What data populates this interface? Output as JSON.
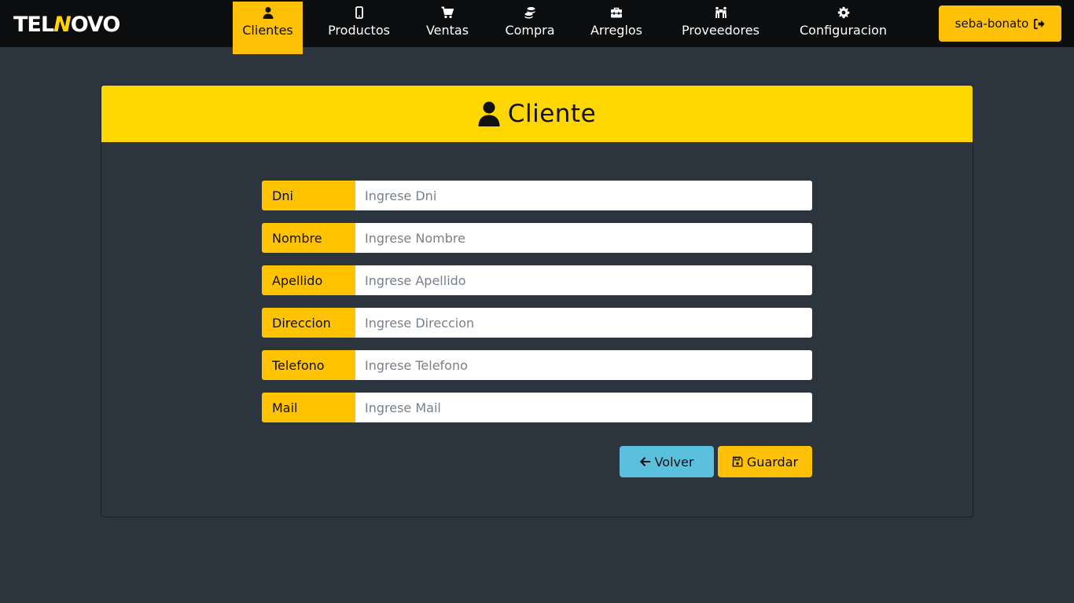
{
  "brand": {
    "logo_left": "TEL",
    "logo_accent": "N",
    "logo_right": "OVO"
  },
  "nav": {
    "items": [
      {
        "label": "Clientes",
        "icon": "user-icon",
        "active": true
      },
      {
        "label": "Productos",
        "icon": "mobile-icon",
        "active": false
      },
      {
        "label": "Ventas",
        "icon": "cart-icon",
        "active": false
      },
      {
        "label": "Compra",
        "icon": "coins-icon",
        "active": false
      },
      {
        "label": "Arreglos",
        "icon": "toolbox-icon",
        "active": false
      },
      {
        "label": "Proveedores",
        "icon": "people-carry-icon",
        "active": false
      },
      {
        "label": "Configuracion",
        "icon": "gear-icon",
        "active": false
      }
    ],
    "user": {
      "label": "seba-bonato",
      "icon": "sign-out-icon"
    }
  },
  "form": {
    "title": "Cliente",
    "fields": [
      {
        "label": "Dni",
        "placeholder": "Ingrese Dni"
      },
      {
        "label": "Nombre",
        "placeholder": "Ingrese Nombre"
      },
      {
        "label": "Apellido",
        "placeholder": "Ingrese Apellido"
      },
      {
        "label": "Direccion",
        "placeholder": "Ingrese Direccion"
      },
      {
        "label": "Telefono",
        "placeholder": "Ingrese Telefono"
      },
      {
        "label": "Mail",
        "placeholder": "Ingrese Mail"
      }
    ],
    "back_label": "Volver",
    "save_label": "Guardar"
  },
  "colors": {
    "accent": "#ffc107",
    "header": "#ffd700",
    "info": "#5bc0de",
    "background": "#2c353d",
    "navbar": "#0b0d0f"
  }
}
